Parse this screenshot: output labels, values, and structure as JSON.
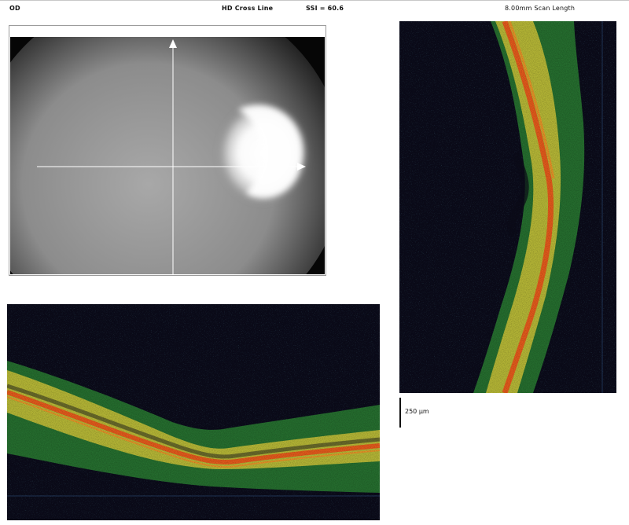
{
  "header": {
    "eye": "OD",
    "scan_type": "HD Cross Line",
    "ssi": "SSI = 60.6",
    "scan_length": "8.00mm Scan Length"
  },
  "scale": {
    "label": "250 µm"
  },
  "icons": {
    "vertical_arrow": "arrow-up-icon",
    "horizontal_arrow": "arrow-right-icon"
  },
  "colors": {
    "oct_background": "#0b0b1a",
    "oct_rpe": "#e8501a",
    "oct_mid": "#f4d43a",
    "oct_outer": "#3fae3a",
    "scan_line": "#ffffff"
  }
}
